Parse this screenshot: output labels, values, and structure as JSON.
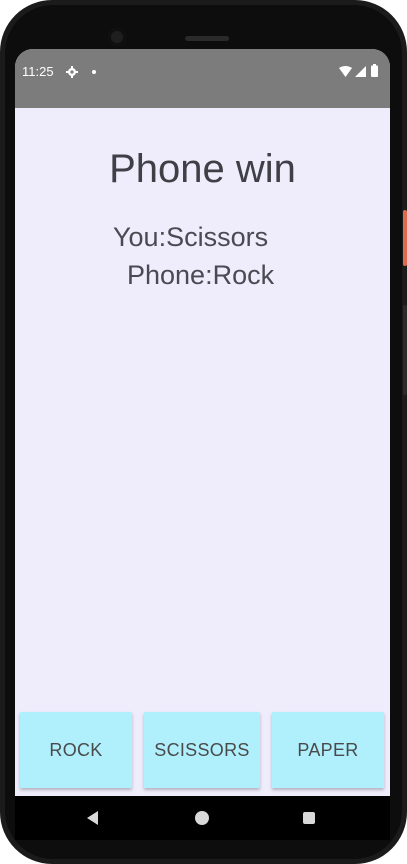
{
  "status_bar": {
    "time": "11:25",
    "icons": [
      "gear-icon",
      "notification-dot-icon",
      "wifi-icon",
      "signal-icon",
      "battery-icon"
    ]
  },
  "game": {
    "result": "Phone win",
    "you_choice": "You:Scissors",
    "phone_choice": "Phone:Rock"
  },
  "buttons": {
    "rock": "ROCK",
    "scissors": "SCISSORS",
    "paper": "PAPER"
  },
  "navigation": {
    "icons": [
      "back-icon",
      "home-icon",
      "recents-icon"
    ]
  },
  "colors": {
    "screen_background": "#efecfc",
    "status_bar": "#7c7c7c",
    "button_background": "#b0f0fd",
    "text": "#3f3f46"
  }
}
